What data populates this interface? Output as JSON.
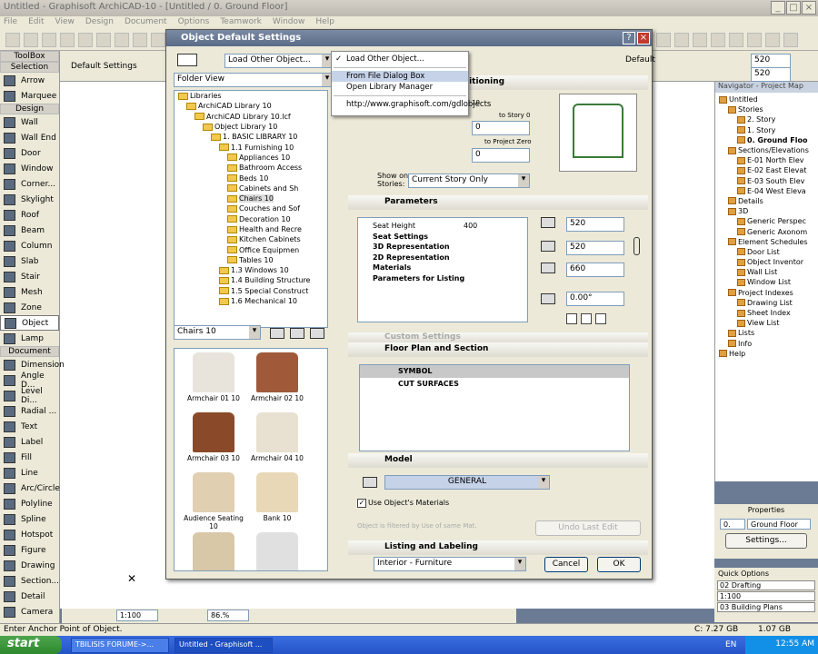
{
  "app": {
    "title": "Untitled - Graphisoft ArchiCAD-10 - [Untitled / 0. Ground Floor]"
  },
  "menubar": [
    "File",
    "Edit",
    "View",
    "Design",
    "Document",
    "Options",
    "Teamwork",
    "Window",
    "Help"
  ],
  "infobox": {
    "label": "Default Settings",
    "field1": "520",
    "field2": "520"
  },
  "toolbox": {
    "title": "ToolBox",
    "selection": "Selection",
    "sections": {
      "design": "Design",
      "document": "Document"
    },
    "tools_top": [
      "Arrow",
      "Marquee"
    ],
    "tools_design": [
      "Wall",
      "Wall End",
      "Door",
      "Window",
      "Corner...",
      "Skylight",
      "Roof",
      "Beam",
      "Column",
      "Slab",
      "Stair",
      "Mesh",
      "Zone",
      "Object",
      "Lamp"
    ],
    "tools_document": [
      "Dimension",
      "Angle D...",
      "Level Di...",
      "Radial ...",
      "Text",
      "Label",
      "Fill",
      "Line",
      "Arc/Circle",
      "Polyline",
      "Spline",
      "Hotspot",
      "Figure",
      "Drawing",
      "Section...",
      "Detail",
      "Camera"
    ]
  },
  "dialog": {
    "title": "Object Default Settings",
    "default_label": "Default",
    "load_button": "Load Other Object...",
    "view_combo": "Folder View",
    "tree": [
      "Libraries",
      "ArchiCAD Library 10",
      "ArchiCAD Library 10.lcf",
      "Object Library 10",
      "1. BASIC LIBRARY 10",
      "1.1 Furnishing 10",
      "Appliances 10",
      "Bathroom Access",
      "Beds 10",
      "Cabinets and Sh",
      "Chairs 10",
      "Couches and Sof",
      "Decoration 10",
      "Health and Recre",
      "Kitchen Cabinets",
      "Office Equipmen",
      "Tables 10",
      "1.3 Windows 10",
      "1.4 Building Structure",
      "1.5 Special Construct",
      "1.6 Mechanical 10"
    ],
    "folder_combo": "Chairs 10",
    "objects": [
      "Armchair 01 10",
      "Armchair 02 10",
      "Armchair 03 10",
      "Armchair 04 10",
      "Audience Seating 10",
      "Bank 10",
      "",
      ""
    ],
    "geometry": {
      "header": "Geometry and Positioning",
      "field_a": "0",
      "to_story_label": "to Story 0",
      "field_b": "0",
      "to_project_label": "to Project Zero",
      "field_c": "0",
      "show_on_label": "Show on Stories:",
      "show_on_value": "Current Story Only",
      "hidden_label": "10"
    },
    "parameters": {
      "header": "Parameters",
      "rows": [
        {
          "name": "Seat Height",
          "value": "400"
        },
        {
          "name": "Seat Settings"
        },
        {
          "name": "3D Representation"
        },
        {
          "name": "2D Representation"
        },
        {
          "name": "Materials"
        },
        {
          "name": "Parameters for Listing"
        }
      ],
      "field_a": "520",
      "field_b": "520",
      "field_c": "660",
      "angle": "0.00°"
    },
    "custom_settings": "Custom Settings",
    "floor_plan": {
      "header": "Floor Plan and Section",
      "rows": [
        "SYMBOL",
        "CUT SURFACES"
      ]
    },
    "model": {
      "header": "Model",
      "material": "GENERAL",
      "use_materials": "Use Object's Materials",
      "disabled_note": "Object is filtered by Use of same Mat.",
      "undo_button": "Undo Last Edit"
    },
    "listing": {
      "header": "Listing and Labeling"
    },
    "layer": "Interior - Furniture",
    "cancel": "Cancel",
    "ok": "OK"
  },
  "dropdown": {
    "items": [
      "Load Other Object...",
      "From File Dialog Box",
      "Open Library Manager",
      "http://www.graphisoft.com/gdlobjects"
    ]
  },
  "navigator": {
    "title": "Navigator - Project Map",
    "items": [
      {
        "t": "Untitled",
        "d": 0
      },
      {
        "t": "Stories",
        "d": 1
      },
      {
        "t": "2. Story",
        "d": 2
      },
      {
        "t": "1. Story",
        "d": 2
      },
      {
        "t": "0. Ground Floo",
        "d": 2,
        "b": true
      },
      {
        "t": "Sections/Elevations",
        "d": 1
      },
      {
        "t": "E-01 North Elev",
        "d": 2
      },
      {
        "t": "E-02 East Elevat",
        "d": 2
      },
      {
        "t": "E-03 South Elev",
        "d": 2
      },
      {
        "t": "E-04 West Eleva",
        "d": 2
      },
      {
        "t": "Details",
        "d": 1
      },
      {
        "t": "3D",
        "d": 1
      },
      {
        "t": "Generic Perspec",
        "d": 2
      },
      {
        "t": "Generic Axonom",
        "d": 2
      },
      {
        "t": "Element Schedules",
        "d": 1
      },
      {
        "t": "Door List",
        "d": 2
      },
      {
        "t": "Object Inventor",
        "d": 2
      },
      {
        "t": "Wall List",
        "d": 2
      },
      {
        "t": "Window List",
        "d": 2
      },
      {
        "t": "Project Indexes",
        "d": 1
      },
      {
        "t": "Drawing List",
        "d": 2
      },
      {
        "t": "Sheet Index",
        "d": 2
      },
      {
        "t": "View List",
        "d": 2
      },
      {
        "t": "Lists",
        "d": 1
      },
      {
        "t": "Info",
        "d": 1
      },
      {
        "t": "Help",
        "d": 0
      }
    ]
  },
  "properties": {
    "title": "Properties",
    "story_no": "0.",
    "story_name": "Ground Floor",
    "settings_button": "Settings..."
  },
  "quick": {
    "title": "Quick Options",
    "items": [
      "02 Drafting",
      "1:100",
      "03 Building Plans"
    ]
  },
  "view": {
    "scale": "1:100",
    "zoom": "86.%"
  },
  "status": {
    "text": "Enter Anchor Point of Object.",
    "disk": "C: 7.27 GB",
    "mem": "1.07 GB"
  },
  "taskbar": {
    "start": "start",
    "tasks": [
      "TBILISIS FORUME->...",
      "Untitled - Graphisoft ..."
    ],
    "lang": "EN",
    "clock": "12:55 AM"
  }
}
